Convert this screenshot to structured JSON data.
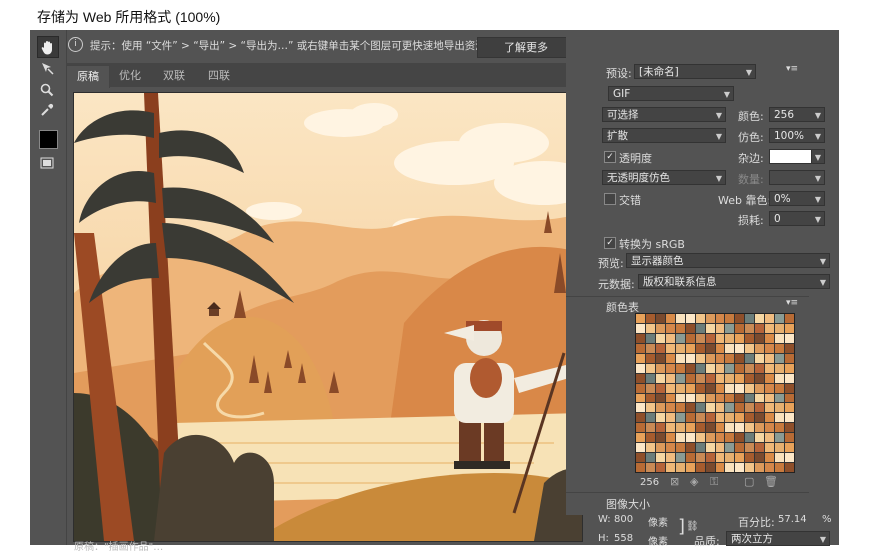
{
  "window": {
    "title": "存储为 Web 所用格式 (100%)"
  },
  "tip": {
    "text": "提示：使用 “文件” > “导出” > “导出为…” 或右键单击某个图层可更快速地导出资源",
    "learn_more": "了解更多"
  },
  "tabs": [
    "原稿",
    "优化",
    "双联",
    "四联"
  ],
  "status": {
    "text": "原稿：\"插画作品\"…"
  },
  "settings": {
    "preset_label": "预设:",
    "preset_value": "[未命名]",
    "format": "GIF",
    "reduction": "可选择",
    "colors_label": "颜色:",
    "colors_value": "256",
    "dither_algo": "扩散",
    "dither_label": "仿色:",
    "dither_value": "100%",
    "transparency_label": "透明度",
    "matte_label": "杂边:",
    "transparency_dither": "无透明度仿色",
    "amount_label": "数量:",
    "interlaced_label": "交错",
    "websnap_label": "Web 靠色:",
    "websnap_value": "0%",
    "lossy_label": "损耗:",
    "lossy_value": "0",
    "convert_srgb_label": "转换为 sRGB",
    "preview_label": "预览:",
    "preview_value": "显示器颜色",
    "metadata_label": "元数据:",
    "metadata_value": "版权和联系信息"
  },
  "color_table": {
    "title": "颜色表",
    "count": "256",
    "palette": [
      "#e8a25a",
      "#d98b48",
      "#f2c58a",
      "#c77a3e",
      "#f6d7a3",
      "#b86b35",
      "#efb877",
      "#a65c2e",
      "#f9e2bd",
      "#dc9a5c",
      "#8e4f2a",
      "#f0bc80",
      "#c98a55",
      "#e6b070",
      "#7a4a2e",
      "#fde8c8",
      "#d4874a",
      "#6b7d7a",
      "#8a9b94",
      "#b5643a"
    ]
  },
  "image_size": {
    "title": "图像大小",
    "w_label": "W:",
    "w_value": "800",
    "h_label": "H:",
    "h_value": "558",
    "unit": "像素",
    "percent_label": "百分比:",
    "percent_value": "57.14",
    "percent_unit": "%",
    "quality_label": "品质:",
    "quality_value": "两次立方"
  }
}
